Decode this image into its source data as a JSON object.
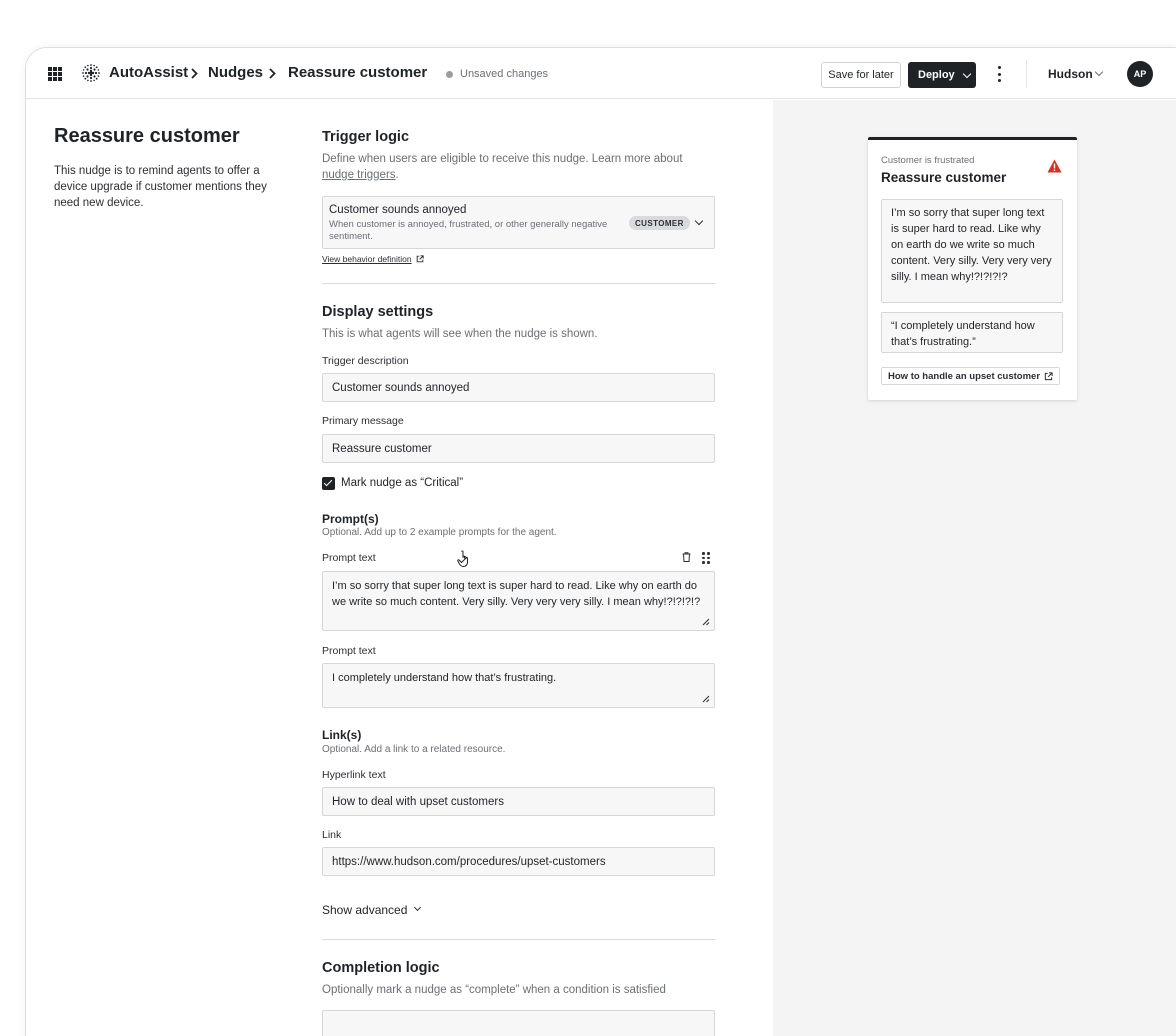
{
  "header": {
    "brand": "AutoAssist",
    "breadcrumb": [
      "Nudges",
      "Reassure customer"
    ],
    "status": "Unsaved changes",
    "save_label": "Save for later",
    "deploy_label": "Deploy",
    "org": "Hudson",
    "avatar_initials": "AP"
  },
  "page": {
    "title": "Reassure customer",
    "description": "This nudge is to remind agents to offer a device upgrade if customer mentions they need new device."
  },
  "trigger_logic": {
    "heading": "Trigger logic",
    "description": "Define when users are eligible to receive this nudge. Learn more about",
    "description_link": "nudge triggers",
    "description_end": ".",
    "selected_title": "Customer sounds annoyed",
    "selected_description": "When customer is annoyed, frustrated, or other generally negative sentiment.",
    "badge": "CUSTOMER",
    "view_link": "View behavior definition"
  },
  "display_settings": {
    "heading": "Display settings",
    "description": "This is what agents will see when the nudge is shown.",
    "trigger_description_label": "Trigger description",
    "trigger_description_value": "Customer sounds annoyed",
    "primary_message_label": "Primary message",
    "primary_message_value": "Reassure customer",
    "critical_label": "Mark nudge as “Critical”",
    "critical_checked": true
  },
  "prompts": {
    "heading": "Prompt(s)",
    "description": "Optional. Add up to 2 example prompts for the agent.",
    "items": [
      {
        "label": "Prompt text",
        "value": "I’m so sorry that super long text is super hard to read. Like why on earth do we write so much content. Very silly. Very very very silly. I mean why!?!?!?!?"
      },
      {
        "label": "Prompt text",
        "value": "I completely understand how that’s frustrating."
      }
    ]
  },
  "links": {
    "heading": "Link(s)",
    "description": "Optional. Add a link to a related resource.",
    "hyperlink_label": "Hyperlink text",
    "hyperlink_value": "How to deal with upset customers",
    "link_label": "Link",
    "link_value": "https://www.hudson.com/procedures/upset-customers"
  },
  "show_advanced": "Show advanced",
  "completion_logic": {
    "heading": "Completion logic",
    "description": "Optionally mark a nudge as “complete” when a condition is satisfied"
  },
  "preview_card": {
    "kicker": "Customer is frustrated",
    "title": "Reassure customer",
    "prompt_1": "I’m so sorry that super long text is super hard to read. Like why on earth do we write so much content. Very silly. Very very very silly. I mean why!?!?!?!?",
    "prompt_2": "“I completely understand how that’s frustrating.”",
    "link": "How to handle an upset customer"
  },
  "colors": {
    "primary": "#1f2328",
    "panel_bg": "#f4f4f5",
    "warning": "#d93025"
  }
}
